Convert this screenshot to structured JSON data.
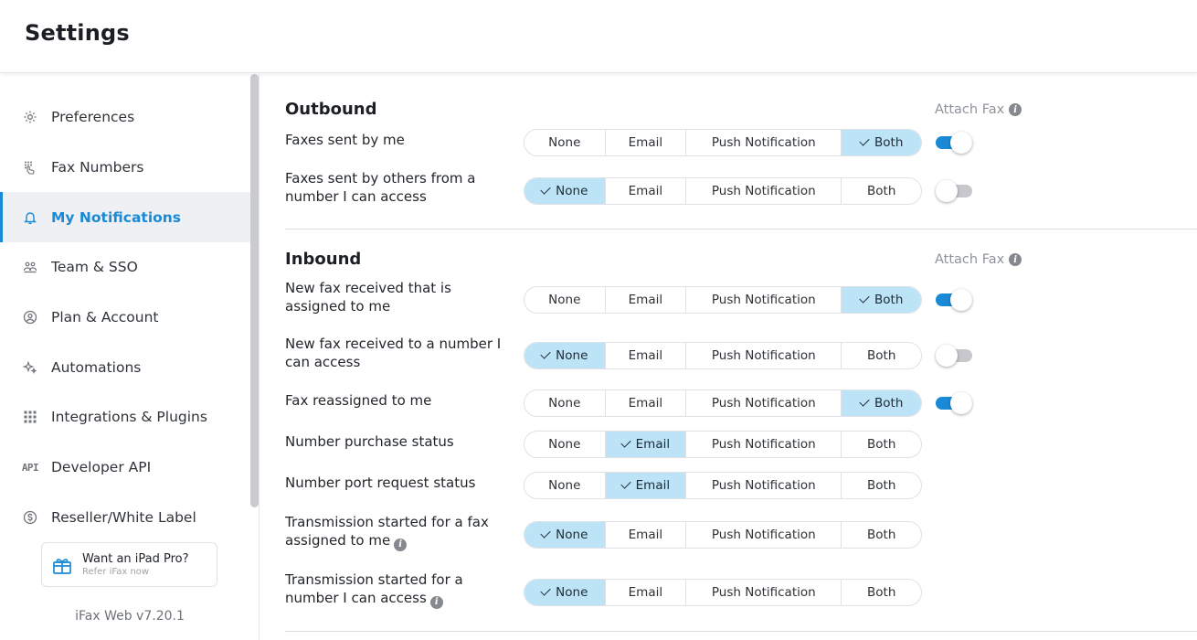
{
  "header": {
    "title": "Settings"
  },
  "sidebar": {
    "items": [
      {
        "label": "Preferences",
        "icon": "gear-icon"
      },
      {
        "label": "Fax Numbers",
        "icon": "keypad-hand-icon"
      },
      {
        "label": "My Notifications",
        "icon": "bell-icon",
        "active": true
      },
      {
        "label": "Team & SSO",
        "icon": "team-icon"
      },
      {
        "label": "Plan & Account",
        "icon": "user-circle-icon"
      },
      {
        "label": "Automations",
        "icon": "sparkle-icon"
      },
      {
        "label": "Integrations & Plugins",
        "icon": "grid-icon"
      },
      {
        "label": "Developer API",
        "icon": "api-icon",
        "glyph": "API"
      },
      {
        "label": "Reseller/White Label",
        "icon": "dollar-circle-icon"
      }
    ],
    "promo": {
      "title": "Want an iPad Pro?",
      "subtitle": "Refer iFax now"
    },
    "version": "iFax Web v7.20.1"
  },
  "options": [
    "None",
    "Email",
    "Push Notification",
    "Both"
  ],
  "outbound": {
    "title": "Outbound",
    "attach_label": "Attach Fax",
    "rows": [
      {
        "label": "Faxes sent by me",
        "selected": "Both",
        "attach": true
      },
      {
        "label": "Faxes sent by others from a number I can access",
        "selected": "None",
        "attach": false
      }
    ]
  },
  "inbound": {
    "title": "Inbound",
    "attach_label": "Attach Fax",
    "rows": [
      {
        "label": "New fax received that is assigned to me",
        "selected": "Both",
        "attach": true
      },
      {
        "label": "New fax received to a number I can access",
        "selected": "None",
        "attach": false
      },
      {
        "label": "Fax reassigned to me",
        "selected": "Both",
        "attach": true
      },
      {
        "label": "Number purchase status",
        "selected": "Email"
      },
      {
        "label": "Number port request status",
        "selected": "Email"
      },
      {
        "label": "Transmission started for a fax assigned to me",
        "selected": "None",
        "info": true
      },
      {
        "label": "Transmission started for a number I can access",
        "selected": "None",
        "info": true
      }
    ]
  }
}
